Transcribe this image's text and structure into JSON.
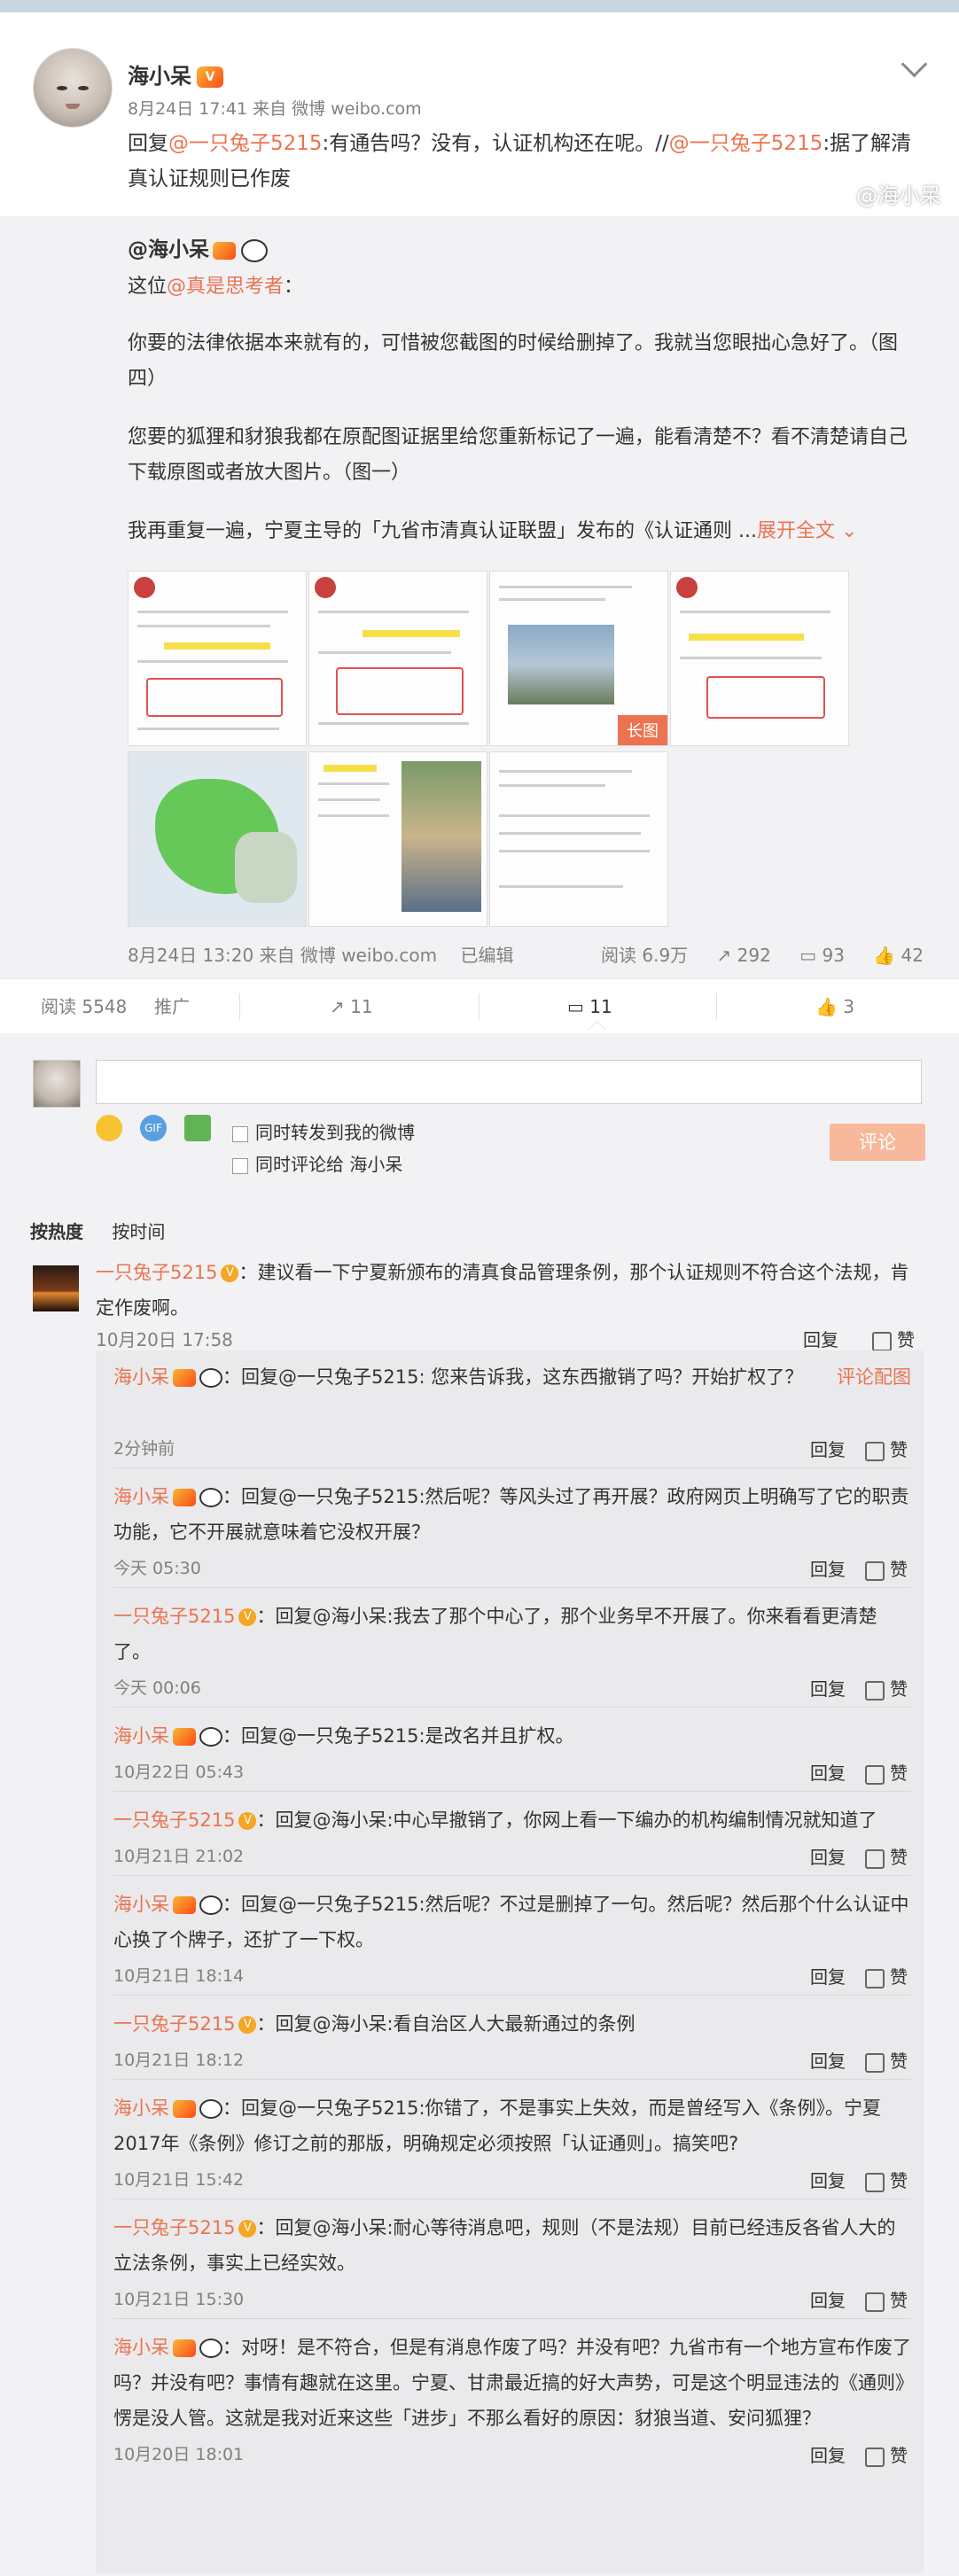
{
  "post": {
    "author": "海小呆",
    "meta": "8月24日 17:41 来自 微博 weibo.com",
    "reply_prefix": "回复",
    "reply_at1": "@一只兔子5215",
    "reply_mid": ":有通告吗？没有，认证机构还在呢。//",
    "reply_at2": "@一只兔子5215",
    "reply_tail": ":据了解清真认证规则已作废"
  },
  "original": {
    "author": "@海小呆",
    "line1_prefix": "这位",
    "line1_at": "@真是思考者",
    "line1_suffix": "：",
    "para1": "你要的法律依据本来就有的，可惜被您截图的时候给删掉了。我就当您眼拙心急好了。（图四）",
    "para2": "您要的狐狸和豺狼我都在原配图证据里给您重新标记了一遍，能看清楚不？看不清楚请自己下载原图或者放大图片。（图一）",
    "para3": "我再重复一遍，宁夏主导的「九省市清真认证联盟」发布的《认证通则 ...",
    "expand": "展开全文",
    "long_image_badge": "长图",
    "meta": "8月24日 13:20 来自 微博 weibo.com",
    "edited": "已编辑",
    "reads": "阅读 6.9万",
    "reposts": "292",
    "comments": "93",
    "likes": "42"
  },
  "actions": {
    "reads": "阅读 5548",
    "promote": "推广",
    "repost_count": "11",
    "comment_count": "11",
    "like_count": "3"
  },
  "composer": {
    "check1": "同时转发到我的微博",
    "check2": "同时评论给 海小呆",
    "submit": "评论"
  },
  "sort": {
    "hot": "按热度",
    "time": "按时间"
  },
  "comment_main": {
    "author": "一只兔子5215",
    "text": "：建议看一下宁夏新颁布的清真食品管理条例，那个认证规则不符合这个法规，肯定作废啊。",
    "time": "10月20日 17:58",
    "reply": "回复",
    "like": "赞"
  },
  "replies": [
    {
      "author": "海小呆",
      "body": "：回复@一只兔子5215: 您来告诉我，这东西撤销了吗？开始扩权了？",
      "extra": "评论配图",
      "time": "2分钟前"
    },
    {
      "author": "海小呆",
      "body": "：回复@一只兔子5215:然后呢？等风头过了再开展？政府网页上明确写了它的职责功能，它不开展就意味着它没权开展？",
      "extra": "",
      "time": "今天 05:30"
    },
    {
      "author": "一只兔子5215",
      "body": "：回复@海小呆:我去了那个中心了，那个业务早不开展了。你来看看更清楚了。",
      "extra": "",
      "time": "今天 00:06"
    },
    {
      "author": "海小呆",
      "body": "：回复@一只兔子5215:是改名并且扩权。",
      "extra": "",
      "time": "10月22日 05:43"
    },
    {
      "author": "一只兔子5215",
      "body": "：回复@海小呆:中心早撤销了，你网上看一下编办的机构编制情况就知道了",
      "extra": "",
      "time": "10月21日 21:02"
    },
    {
      "author": "海小呆",
      "body": "：回复@一只兔子5215:然后呢？不过是删掉了一句。然后呢？然后那个什么认证中心换了个牌子，还扩了一下权。",
      "extra": "",
      "time": "10月21日 18:14"
    },
    {
      "author": "一只兔子5215",
      "body": "：回复@海小呆:看自治区人大最新通过的条例",
      "extra": "",
      "time": "10月21日 18:12"
    },
    {
      "author": "海小呆",
      "body": "：回复@一只兔子5215:你错了，不是事实上失效，而是曾经写入《条例》。宁夏2017年《条例》修订之前的那版，明确规定必须按照「认证通则」。搞笑吧?",
      "extra": "",
      "time": "10月21日 15:42"
    },
    {
      "author": "一只兔子5215",
      "body": "：回复@海小呆:耐心等待消息吧，规则（不是法规）目前已经违反各省人大的立法条例，事实上已经实效。",
      "extra": "",
      "time": "10月21日 15:30"
    },
    {
      "author": "海小呆",
      "body": "：对呀！是不符合，但是有消息作废了吗？并没有吧？九省市有一个地方宣布作废了吗？并没有吧？事情有趣就在这里。宁夏、甘肃最近搞的好大声势，可是这个明显违法的《通则》愣是没人管。这就是我对近来这些「进步」不那么看好的原因：豺狼当道、安问狐狸？",
      "extra": "",
      "time": "10月20日 18:01"
    }
  ],
  "reply_label": "回复",
  "like_label": "赞",
  "watermark": "@海小呆"
}
